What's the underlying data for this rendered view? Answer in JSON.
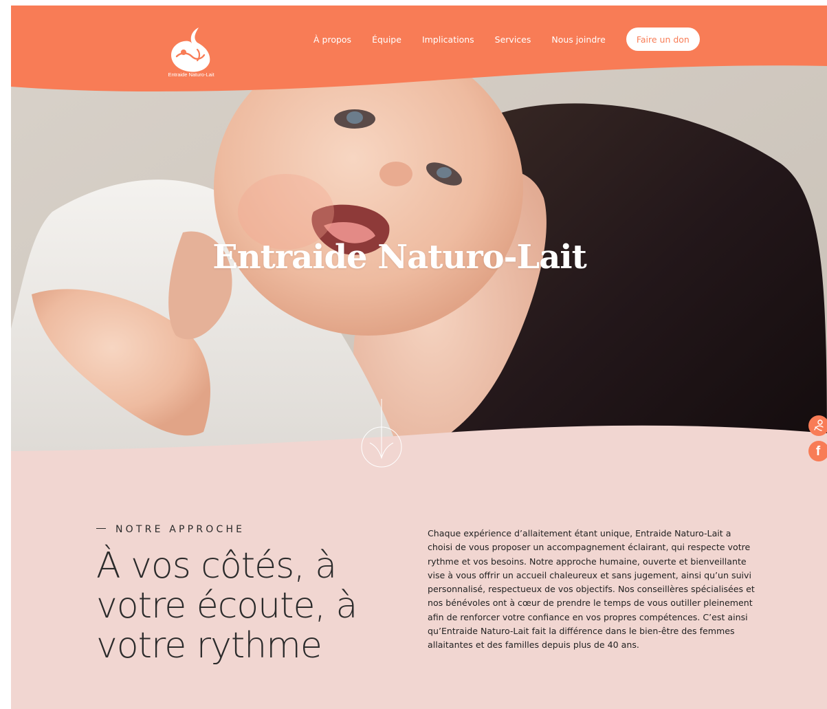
{
  "brand": {
    "name": "Entraide Naturo-Lait",
    "logo_icon": "mother-baby-drop-icon",
    "primary_color": "#f87c56",
    "section_bg_color": "#f1d6d1"
  },
  "nav": {
    "items": [
      {
        "label": "À propos"
      },
      {
        "label": "Équipe"
      },
      {
        "label": "Implications"
      },
      {
        "label": "Services"
      },
      {
        "label": "Nous joindre"
      }
    ],
    "donate_label": "Faire un don"
  },
  "hero": {
    "title": "Entraide Naturo-Lait",
    "scroll_icon": "arrow-down-circle-icon"
  },
  "side_social": [
    {
      "icon": "breastfeeding-icon"
    },
    {
      "icon": "facebook-icon",
      "glyph": "f"
    }
  ],
  "approach": {
    "eyebrow": "NOTRE APPROCHE",
    "title": "À vos côtés, à votre écoute, à votre rythme",
    "body": "Chaque expérience d’allaitement étant unique, Entraide Naturo-Lait a choisi de vous proposer un accompagnement éclairant, qui respecte votre rythme et vos besoins. Notre approche humaine, ouverte et bienveillante vise à vous offrir un accueil chaleureux et sans jugement, ainsi qu’un suivi personnalisé, respectueux de vos objectifs. Nos conseillères spécialisées et nos bénévoles ont à cœur de prendre le temps de vous outiller pleinement afin de renforcer votre confiance en vos propres compétences. C’est ainsi qu’Entraide Naturo-Lait fait la différence dans le bien-être des femmes allaitantes et des familles depuis plus de 40 ans."
  }
}
